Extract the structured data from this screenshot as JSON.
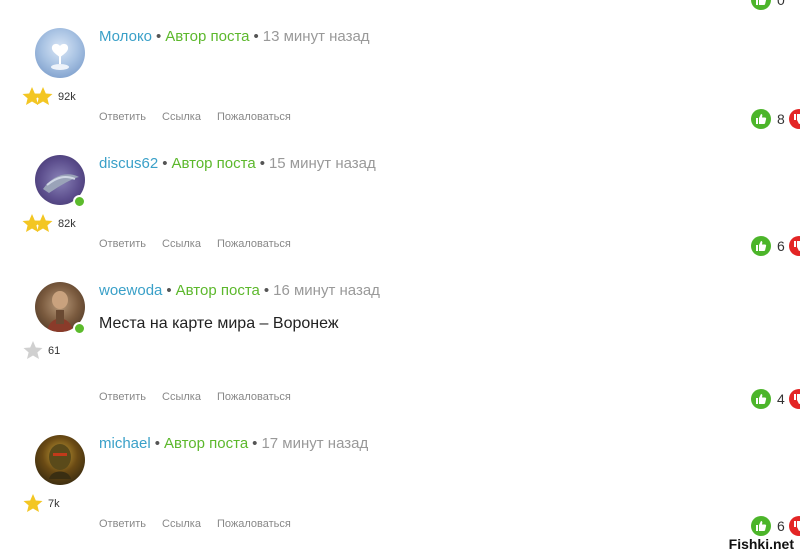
{
  "top_fragment": {
    "count": "0"
  },
  "comments": [
    {
      "author": "Молоко",
      "op_badge": "Автор поста",
      "time": "13 минут назад",
      "rank": "92k",
      "text": "",
      "actions": [
        "Ответить",
        "Ссылка",
        "Пожаловаться"
      ],
      "votes": "8",
      "online": false,
      "stars": 2
    },
    {
      "author": "discus62",
      "op_badge": "Автор поста",
      "time": "15 минут назад",
      "rank": "82k",
      "text": "",
      "actions": [
        "Ответить",
        "Ссылка",
        "Пожаловаться"
      ],
      "votes": "6",
      "online": true,
      "stars": 2
    },
    {
      "author": "woewoda",
      "op_badge": "Автор поста",
      "time": "16 минут назад",
      "rank": "61",
      "text": "Места на карте мира – Воронеж",
      "actions": [
        "Ответить",
        "Ссылка",
        "Пожаловаться"
      ],
      "votes": "4",
      "online": true,
      "stars": 1
    },
    {
      "author": "michael",
      "op_badge": "Автор поста",
      "time": "17 минут назад",
      "rank": "7k",
      "text": "",
      "actions": [
        "Ответить",
        "Ссылка",
        "Пожаловаться"
      ],
      "votes": "6",
      "online": false,
      "stars": 1
    }
  ],
  "watermark": "Fishki.net"
}
